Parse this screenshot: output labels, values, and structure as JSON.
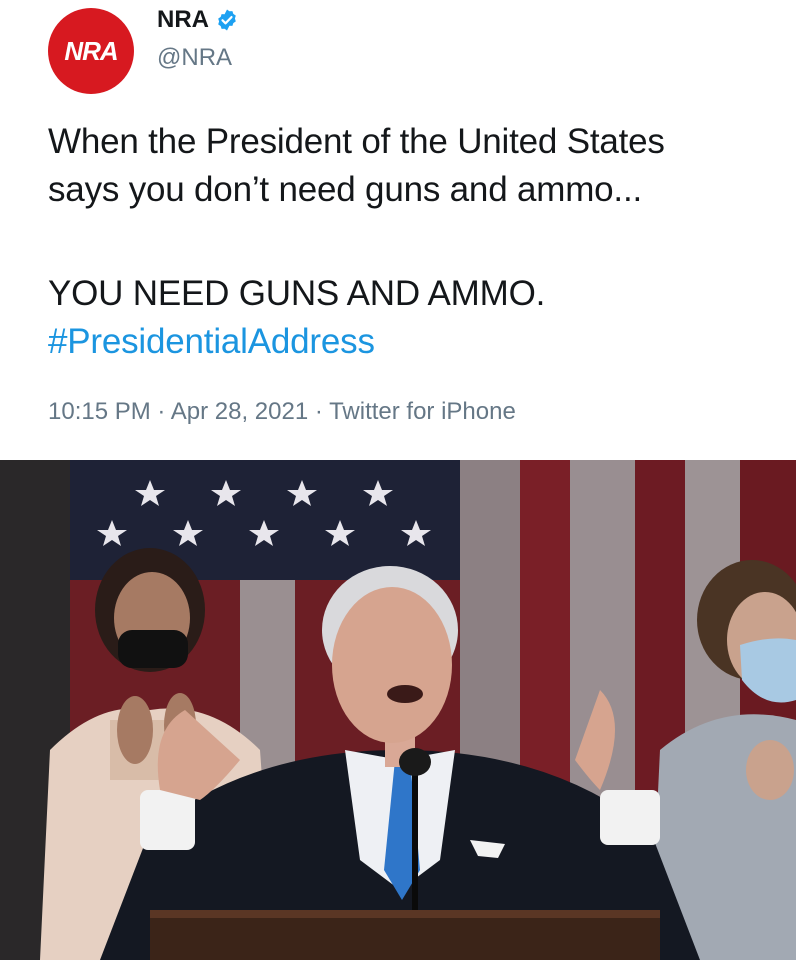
{
  "tweet": {
    "display_name": "NRA",
    "handle": "@NRA",
    "avatar_text": "NRA",
    "verified_icon": "verified-badge-icon",
    "text_lines": [
      "When the President of the United States",
      "says you don’t need guns and ammo..."
    ],
    "text_line_3": "YOU NEED GUNS AND AMMO.",
    "hashtag": "#PresidentialAddress",
    "timestamp": "10:15 PM · Apr 28, 2021 · Twitter for iPhone"
  },
  "colors": {
    "brand_red": "#d71920",
    "hashtag_blue": "#1b95e0",
    "verified_blue": "#1da1f2",
    "meta_gray": "#657786"
  }
}
